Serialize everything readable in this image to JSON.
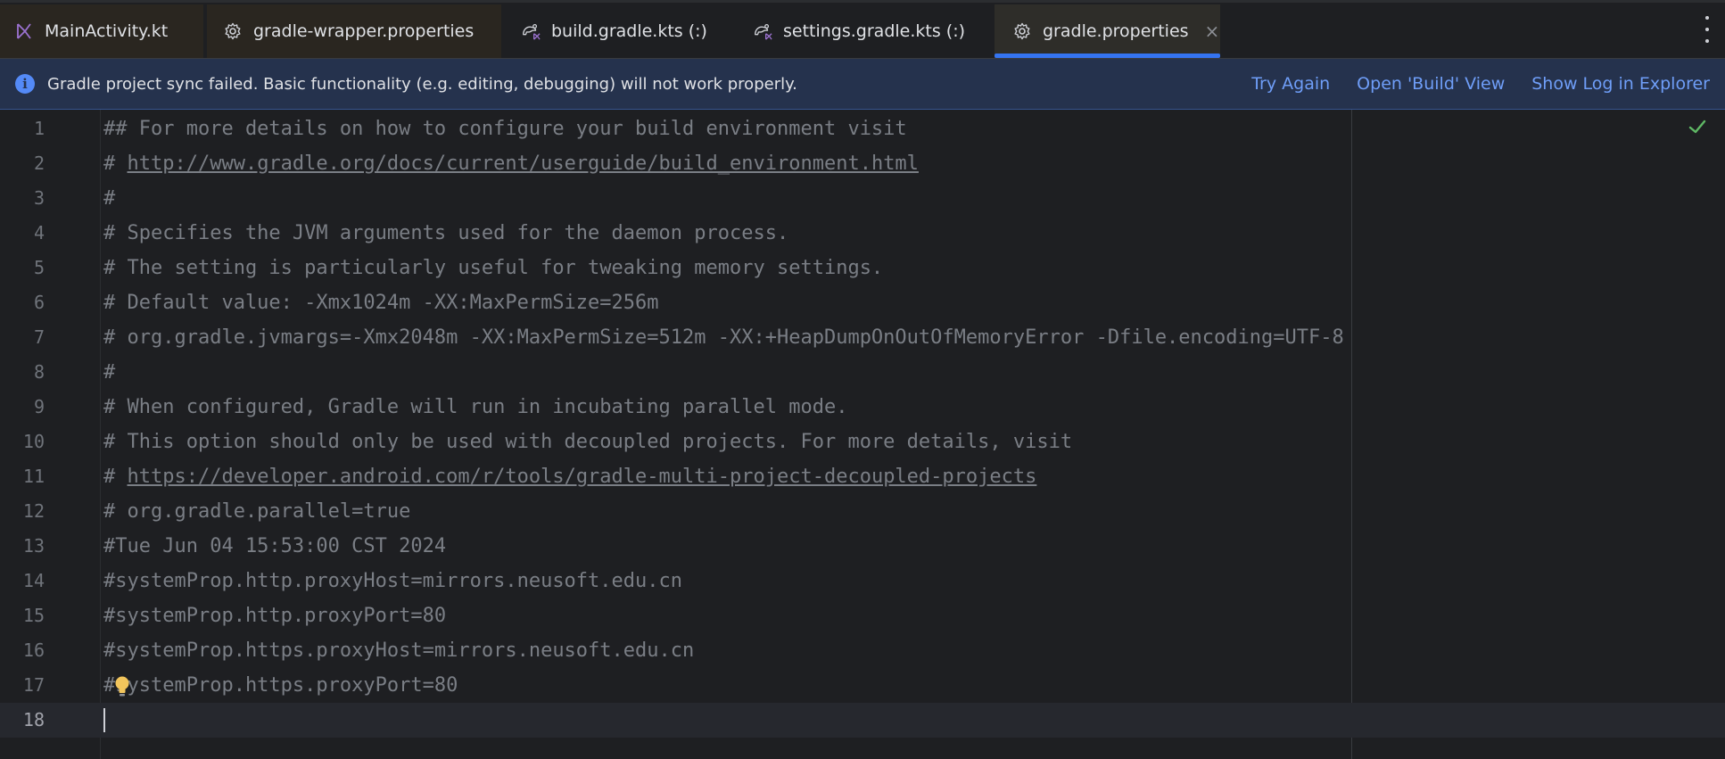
{
  "tabs": [
    {
      "label": "MainActivity.kt",
      "icon": "kotlin-file-icon",
      "state": "modified"
    },
    {
      "label": "gradle-wrapper.properties",
      "icon": "gear-icon",
      "state": "modified"
    },
    {
      "label": "build.gradle.kts (:)",
      "icon": "gradle-kts-icon",
      "state": "normal"
    },
    {
      "label": "settings.gradle.kts (:)",
      "icon": "gradle-kts-icon",
      "state": "normal"
    },
    {
      "label": "gradle.properties",
      "icon": "gear-icon",
      "state": "active",
      "close": "×"
    }
  ],
  "banner": {
    "message": "Gradle project sync failed. Basic functionality (e.g. editing, debugging) will not work properly.",
    "try_again": "Try Again",
    "open_build": "Open 'Build' View",
    "show_log": "Show Log in Explorer"
  },
  "editor": {
    "current_line": 18,
    "lines": [
      {
        "n": "1",
        "text": "## For more details on how to configure your build environment visit"
      },
      {
        "n": "2",
        "prefix": "# ",
        "link": "http://www.gradle.org/docs/current/userguide/build_environment.html"
      },
      {
        "n": "3",
        "text": "#"
      },
      {
        "n": "4",
        "text": "# Specifies the JVM arguments used for the daemon process."
      },
      {
        "n": "5",
        "text": "# The setting is particularly useful for tweaking memory settings."
      },
      {
        "n": "6",
        "text": "# Default value: -Xmx1024m -XX:MaxPermSize=256m"
      },
      {
        "n": "7",
        "text": "# org.gradle.jvmargs=-Xmx2048m -XX:MaxPermSize=512m -XX:+HeapDumpOnOutOfMemoryError -Dfile.encoding=UTF-8"
      },
      {
        "n": "8",
        "text": "#"
      },
      {
        "n": "9",
        "text": "# When configured, Gradle will run in incubating parallel mode."
      },
      {
        "n": "10",
        "text": "# This option should only be used with decoupled projects. For more details, visit"
      },
      {
        "n": "11",
        "prefix": "# ",
        "link": "https://developer.android.com/r/tools/gradle-multi-project-decoupled-projects"
      },
      {
        "n": "12",
        "text": "# org.gradle.parallel=true"
      },
      {
        "n": "13",
        "text": "#Tue Jun 04 15:53:00 CST 2024"
      },
      {
        "n": "14",
        "text": "#systemProp.http.proxyHost=mirrors.neusoft.edu.cn"
      },
      {
        "n": "15",
        "text": "#systemProp.http.proxyPort=80"
      },
      {
        "n": "16",
        "text": "#systemProp.https.proxyHost=mirrors.neusoft.edu.cn"
      },
      {
        "n": "17",
        "text": "#systemProp.https.proxyPort=80"
      },
      {
        "n": "18",
        "text": ""
      }
    ]
  },
  "colors": {
    "accent": "#3574f0",
    "link": "#6f9ef8",
    "banner_bg": "#25324d",
    "comment": "#7a7e85",
    "check": "#5fb865",
    "bulb": "#f2c55c"
  }
}
